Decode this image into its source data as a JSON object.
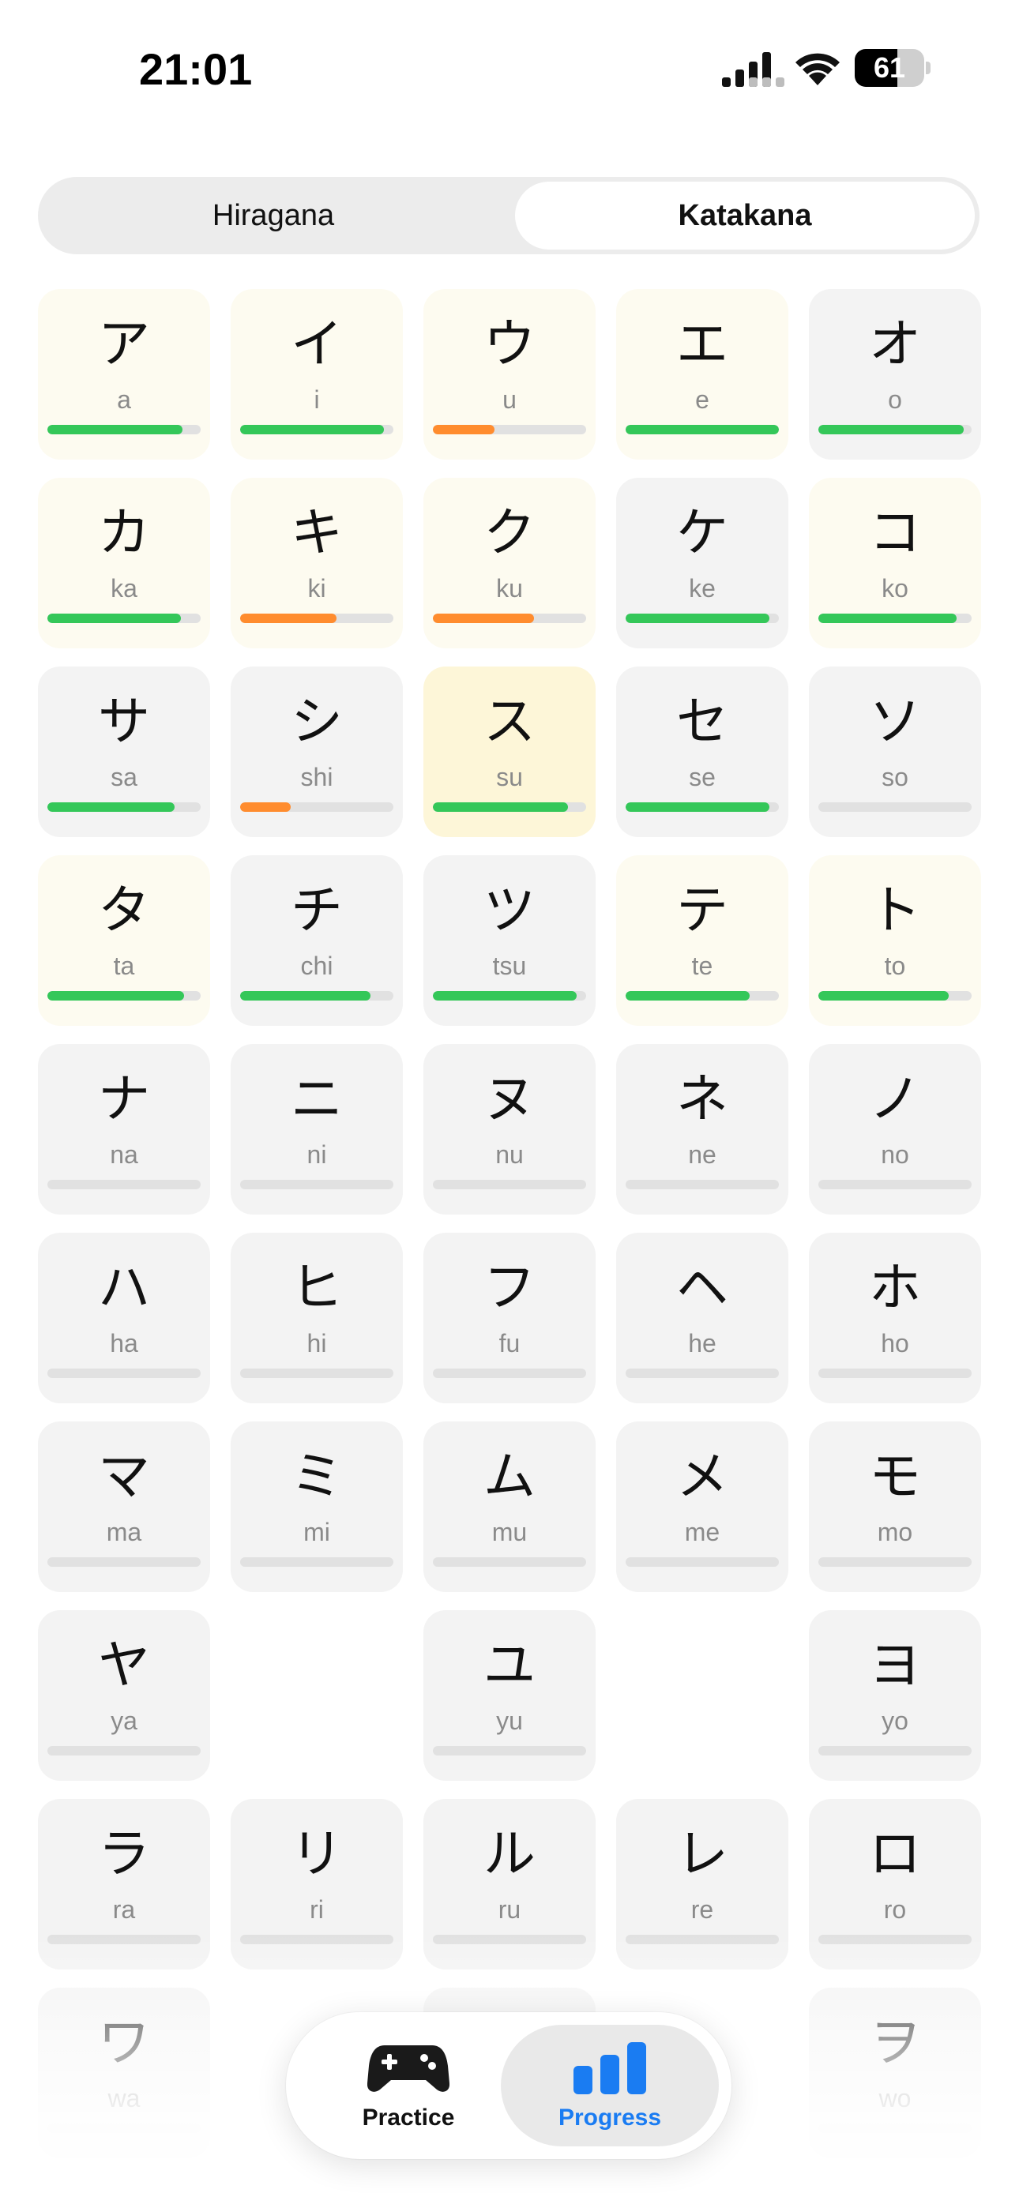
{
  "status_bar": {
    "time": "21:01",
    "battery": "61",
    "battery_level": 0.61,
    "icons": [
      "signal-icon",
      "wifi-icon",
      "battery-icon"
    ]
  },
  "segment": {
    "left_label": "Hiragana",
    "right_label": "Katakana",
    "selected": "Katakana"
  },
  "colors": {
    "progress_green": "#34c759",
    "progress_orange": "#ff8c2e",
    "accent_blue": "#1a7cf2",
    "card_default": "#f3f3f3",
    "card_highlight": "#fdfbf0",
    "card_strong": "#fdf6d8"
  },
  "kana": [
    {
      "char": "ア",
      "romaji": "a",
      "progress": 0.88,
      "color": "green",
      "bg": "hl"
    },
    {
      "char": "イ",
      "romaji": "i",
      "progress": 0.94,
      "color": "green",
      "bg": "hl"
    },
    {
      "char": "ウ",
      "romaji": "u",
      "progress": 0.4,
      "color": "orange",
      "bg": "hl"
    },
    {
      "char": "エ",
      "romaji": "e",
      "progress": 1.0,
      "color": "green",
      "bg": "hl"
    },
    {
      "char": "オ",
      "romaji": "o",
      "progress": 0.95,
      "color": "green",
      "bg": ""
    },
    {
      "char": "カ",
      "romaji": "ka",
      "progress": 0.87,
      "color": "green",
      "bg": "hl"
    },
    {
      "char": "キ",
      "romaji": "ki",
      "progress": 0.63,
      "color": "orange",
      "bg": "hl"
    },
    {
      "char": "ク",
      "romaji": "ku",
      "progress": 0.66,
      "color": "orange",
      "bg": "hl"
    },
    {
      "char": "ケ",
      "romaji": "ke",
      "progress": 0.94,
      "color": "green",
      "bg": ""
    },
    {
      "char": "コ",
      "romaji": "ko",
      "progress": 0.9,
      "color": "green",
      "bg": "hl"
    },
    {
      "char": "サ",
      "romaji": "sa",
      "progress": 0.83,
      "color": "green",
      "bg": ""
    },
    {
      "char": "シ",
      "romaji": "shi",
      "progress": 0.33,
      "color": "orange",
      "bg": ""
    },
    {
      "char": "ス",
      "romaji": "su",
      "progress": 0.88,
      "color": "green",
      "bg": "strong"
    },
    {
      "char": "セ",
      "romaji": "se",
      "progress": 0.94,
      "color": "green",
      "bg": ""
    },
    {
      "char": "ソ",
      "romaji": "so",
      "progress": 0,
      "color": "green",
      "bg": ""
    },
    {
      "char": "タ",
      "romaji": "ta",
      "progress": 0.89,
      "color": "green",
      "bg": "hl"
    },
    {
      "char": "チ",
      "romaji": "chi",
      "progress": 0.85,
      "color": "green",
      "bg": ""
    },
    {
      "char": "ツ",
      "romaji": "tsu",
      "progress": 0.94,
      "color": "green",
      "bg": ""
    },
    {
      "char": "テ",
      "romaji": "te",
      "progress": 0.81,
      "color": "green",
      "bg": "hl"
    },
    {
      "char": "ト",
      "romaji": "to",
      "progress": 0.85,
      "color": "green",
      "bg": "hl"
    },
    {
      "char": "ナ",
      "romaji": "na",
      "progress": 0,
      "color": "green",
      "bg": ""
    },
    {
      "char": "ニ",
      "romaji": "ni",
      "progress": 0,
      "color": "green",
      "bg": ""
    },
    {
      "char": "ヌ",
      "romaji": "nu",
      "progress": 0,
      "color": "green",
      "bg": ""
    },
    {
      "char": "ネ",
      "romaji": "ne",
      "progress": 0,
      "color": "green",
      "bg": ""
    },
    {
      "char": "ノ",
      "romaji": "no",
      "progress": 0,
      "color": "green",
      "bg": ""
    },
    {
      "char": "ハ",
      "romaji": "ha",
      "progress": 0,
      "color": "green",
      "bg": ""
    },
    {
      "char": "ヒ",
      "romaji": "hi",
      "progress": 0,
      "color": "green",
      "bg": ""
    },
    {
      "char": "フ",
      "romaji": "fu",
      "progress": 0,
      "color": "green",
      "bg": ""
    },
    {
      "char": "ヘ",
      "romaji": "he",
      "progress": 0,
      "color": "green",
      "bg": ""
    },
    {
      "char": "ホ",
      "romaji": "ho",
      "progress": 0,
      "color": "green",
      "bg": ""
    },
    {
      "char": "マ",
      "romaji": "ma",
      "progress": 0,
      "color": "green",
      "bg": ""
    },
    {
      "char": "ミ",
      "romaji": "mi",
      "progress": 0,
      "color": "green",
      "bg": ""
    },
    {
      "char": "ム",
      "romaji": "mu",
      "progress": 0,
      "color": "green",
      "bg": ""
    },
    {
      "char": "メ",
      "romaji": "me",
      "progress": 0,
      "color": "green",
      "bg": ""
    },
    {
      "char": "モ",
      "romaji": "mo",
      "progress": 0,
      "color": "green",
      "bg": ""
    },
    {
      "char": "ヤ",
      "romaji": "ya",
      "progress": 0,
      "color": "green",
      "bg": ""
    },
    null,
    {
      "char": "ユ",
      "romaji": "yu",
      "progress": 0,
      "color": "green",
      "bg": ""
    },
    null,
    {
      "char": "ヨ",
      "romaji": "yo",
      "progress": 0,
      "color": "green",
      "bg": ""
    },
    {
      "char": "ラ",
      "romaji": "ra",
      "progress": 0,
      "color": "green",
      "bg": ""
    },
    {
      "char": "リ",
      "romaji": "ri",
      "progress": 0,
      "color": "green",
      "bg": ""
    },
    {
      "char": "ル",
      "romaji": "ru",
      "progress": 0,
      "color": "green",
      "bg": ""
    },
    {
      "char": "レ",
      "romaji": "re",
      "progress": 0,
      "color": "green",
      "bg": ""
    },
    {
      "char": "ロ",
      "romaji": "ro",
      "progress": 0,
      "color": "green",
      "bg": ""
    },
    {
      "char": "ワ",
      "romaji": "wa",
      "progress": 0,
      "color": "green",
      "bg": ""
    },
    null,
    {
      "char": "",
      "romaji": "",
      "progress": 0,
      "color": "green",
      "bg": ""
    },
    null,
    {
      "char": "ヲ",
      "romaji": "wo",
      "progress": 0,
      "color": "green",
      "bg": ""
    }
  ],
  "tabbar": {
    "practice_label": "Practice",
    "progress_label": "Progress",
    "practice_icon": "gamepad-icon",
    "progress_icon": "bar-chart-icon",
    "selected": "Progress"
  }
}
